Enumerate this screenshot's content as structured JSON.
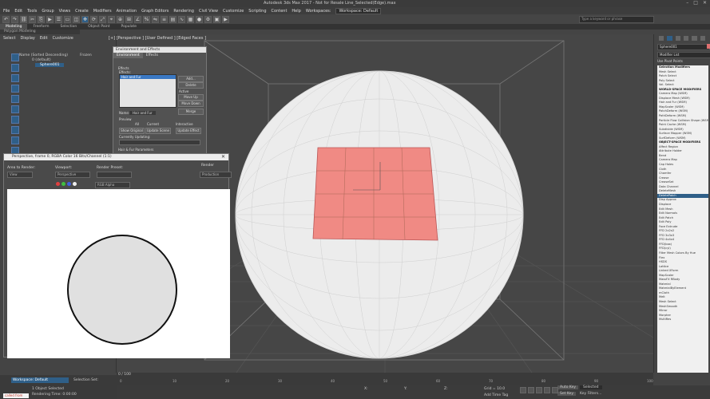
{
  "titlebar": {
    "title": "Autodesk 3ds Max 2017 - Not for Resale   Line_Selected(Edge).max",
    "min": "–",
    "max": "□",
    "close": "✕"
  },
  "menubar": {
    "items": [
      "File",
      "Edit",
      "Tools",
      "Group",
      "Views",
      "Create",
      "Modifiers",
      "Animation",
      "Graph Editors",
      "Rendering",
      "Civil View",
      "Customize",
      "Scripting",
      "Content",
      "Help"
    ],
    "workspace_label": "Workspaces:",
    "workspace": "Workspace: Default"
  },
  "toolbar": {
    "icons": [
      "undo-icon",
      "redo-icon",
      "link-icon",
      "unlink-icon",
      "bind-icon",
      "select-icon",
      "select-name-icon",
      "rect-select-icon",
      "window-icon",
      "move-icon",
      "rotate-icon",
      "scale-icon",
      "ref-coord-icon",
      "pivot-icon",
      "snap-icon",
      "angle-snap-icon",
      "percent-snap-icon",
      "mirror-icon",
      "align-icon",
      "layer-icon",
      "curve-icon",
      "schematic-icon",
      "material-icon",
      "render-setup-icon",
      "render-frame-icon",
      "render-icon"
    ],
    "search_placeholder": "Type a keyword or phrase"
  },
  "ribbon": {
    "tabs": [
      "Modeling",
      "Freeform",
      "Selection",
      "Object Paint",
      "Populate"
    ],
    "subtitle": "Polygon Modeling"
  },
  "scene_explorer": {
    "menu": [
      "Select",
      "Display",
      "Edit",
      "Customize"
    ],
    "column": "Name (Sorted Descending)",
    "column2": "Frozen",
    "rows": [
      "0 (default)",
      "Sphere001"
    ]
  },
  "viewport": {
    "label": "[+] [Perspective ] [User Defined ] [Edged Faces ]"
  },
  "environment": {
    "title": "Environment and Effects",
    "tabs": [
      "Environment",
      "Effects"
    ],
    "section": "Effects",
    "effects_label": "Effects:",
    "list_item": "Hair and Fur",
    "buttons": [
      "Add...",
      "Delete",
      "Move Up",
      "Move Down",
      "Merge"
    ],
    "active": "Active",
    "name_label": "Name:",
    "name_value": "Hair and Fur",
    "preview": "Preview",
    "effects_all": "All",
    "effects_current": "Current",
    "interactive": "Interactive",
    "show_original": "Show Original",
    "update_scene": "Update Scene",
    "update_effect": "Update Effect",
    "currently_updating": "Currently Updating:",
    "bottom": "Hair & Fur Parameters"
  },
  "render_window": {
    "title": "Perspective, frame 0, RGBA Color 16 Bits/Channel (1:1)",
    "area_label": "Area to Render:",
    "area_value": "View",
    "viewport_label": "Viewport:",
    "viewport_value": "Perspective",
    "preset_label": "Render Preset:",
    "render_btn": "Render",
    "mode_value": "Production",
    "channel_value": "RGB Alpha"
  },
  "command_panel": {
    "name": "Sphere001",
    "modifier_list": "Modifier List",
    "use_pivot": "Use Pivot Points",
    "modifiers": [
      {
        "t": "Selection Modifiers",
        "h": true
      },
      {
        "t": "Mesh Select"
      },
      {
        "t": "Patch Select"
      },
      {
        "t": "Poly Select"
      },
      {
        "t": "Vol. Select"
      },
      {
        "t": "WORLD-SPACE MODIFIERS",
        "h": true
      },
      {
        "t": "Camera Map (WSM)"
      },
      {
        "t": "Displace Mesh (WSM)"
      },
      {
        "t": "Hair and Fur (WSM)"
      },
      {
        "t": "MapScaler (WSM)"
      },
      {
        "t": "PatchDeform (WSM)"
      },
      {
        "t": "PathDeform (WSM)"
      },
      {
        "t": "Particle Flow Collision Shape (WSM)"
      },
      {
        "t": "Point Cache (WSM)"
      },
      {
        "t": "Subdivide (WSM)"
      },
      {
        "t": "Surface Mapper (WSM)"
      },
      {
        "t": "SurfDeform (WSM)"
      },
      {
        "t": "OBJECT-SPACE MODIFIERS",
        "h": true
      },
      {
        "t": "Affect Region"
      },
      {
        "t": "Attribute Holder"
      },
      {
        "t": "Bend"
      },
      {
        "t": "Camera Map"
      },
      {
        "t": "Cap Holes"
      },
      {
        "t": "Cloth"
      },
      {
        "t": "Chamfer"
      },
      {
        "t": "Crease"
      },
      {
        "t": "CreaseSet"
      },
      {
        "t": "Data Channel"
      },
      {
        "t": "DeleteMesh"
      },
      {
        "t": "DeletePatch",
        "sel": true
      },
      {
        "t": "Disp Approx"
      },
      {
        "t": "Displace"
      },
      {
        "t": "Edit Mesh"
      },
      {
        "t": "Edit Normals"
      },
      {
        "t": "Edit Patch"
      },
      {
        "t": "Edit Poly"
      },
      {
        "t": "Face Extrude"
      },
      {
        "t": "FFD 2x2x2"
      },
      {
        "t": "FFD 3x3x3"
      },
      {
        "t": "FFD 4x4x4"
      },
      {
        "t": "FFD(box)"
      },
      {
        "t": "FFD(cyl)"
      },
      {
        "t": "Filter Mesh Colors By Hue"
      },
      {
        "t": "Flex"
      },
      {
        "t": "HSDS"
      },
      {
        "t": "Lattice"
      },
      {
        "t": "Linked XForm"
      },
      {
        "t": "MapScaler"
      },
      {
        "t": "MassFX RBody"
      },
      {
        "t": "Material"
      },
      {
        "t": "MaterialByElement"
      },
      {
        "t": "mCloth"
      },
      {
        "t": "Melt"
      },
      {
        "t": "Mesh Select"
      },
      {
        "t": "MeshSmooth"
      },
      {
        "t": "Mirror"
      },
      {
        "t": "Morpher"
      },
      {
        "t": "MultiRes"
      }
    ]
  },
  "timeline": {
    "frame": "0 / 100",
    "ticks": [
      "0",
      "10",
      "20",
      "30",
      "40",
      "50",
      "60",
      "70",
      "80",
      "90",
      "100"
    ]
  },
  "status": {
    "workspace": "Workspace: Default",
    "selection": "Selection Set:",
    "selected": "1 Object Selected",
    "render_time": "Rendering Time: 0:00:00",
    "maxscript": "called from"
  },
  "bottom": {
    "x_label": "X:",
    "y_label": "Y:",
    "z_label": "Z:",
    "grid": "Grid = 10.0",
    "auto": "Auto Key",
    "selected": "Selected",
    "set_key": "Set Key",
    "add_tag": "Add Time Tag",
    "key_filters": "Key Filters..."
  },
  "colors": {
    "accent": "#2f5f88",
    "selection_faces": "#f08a84"
  }
}
